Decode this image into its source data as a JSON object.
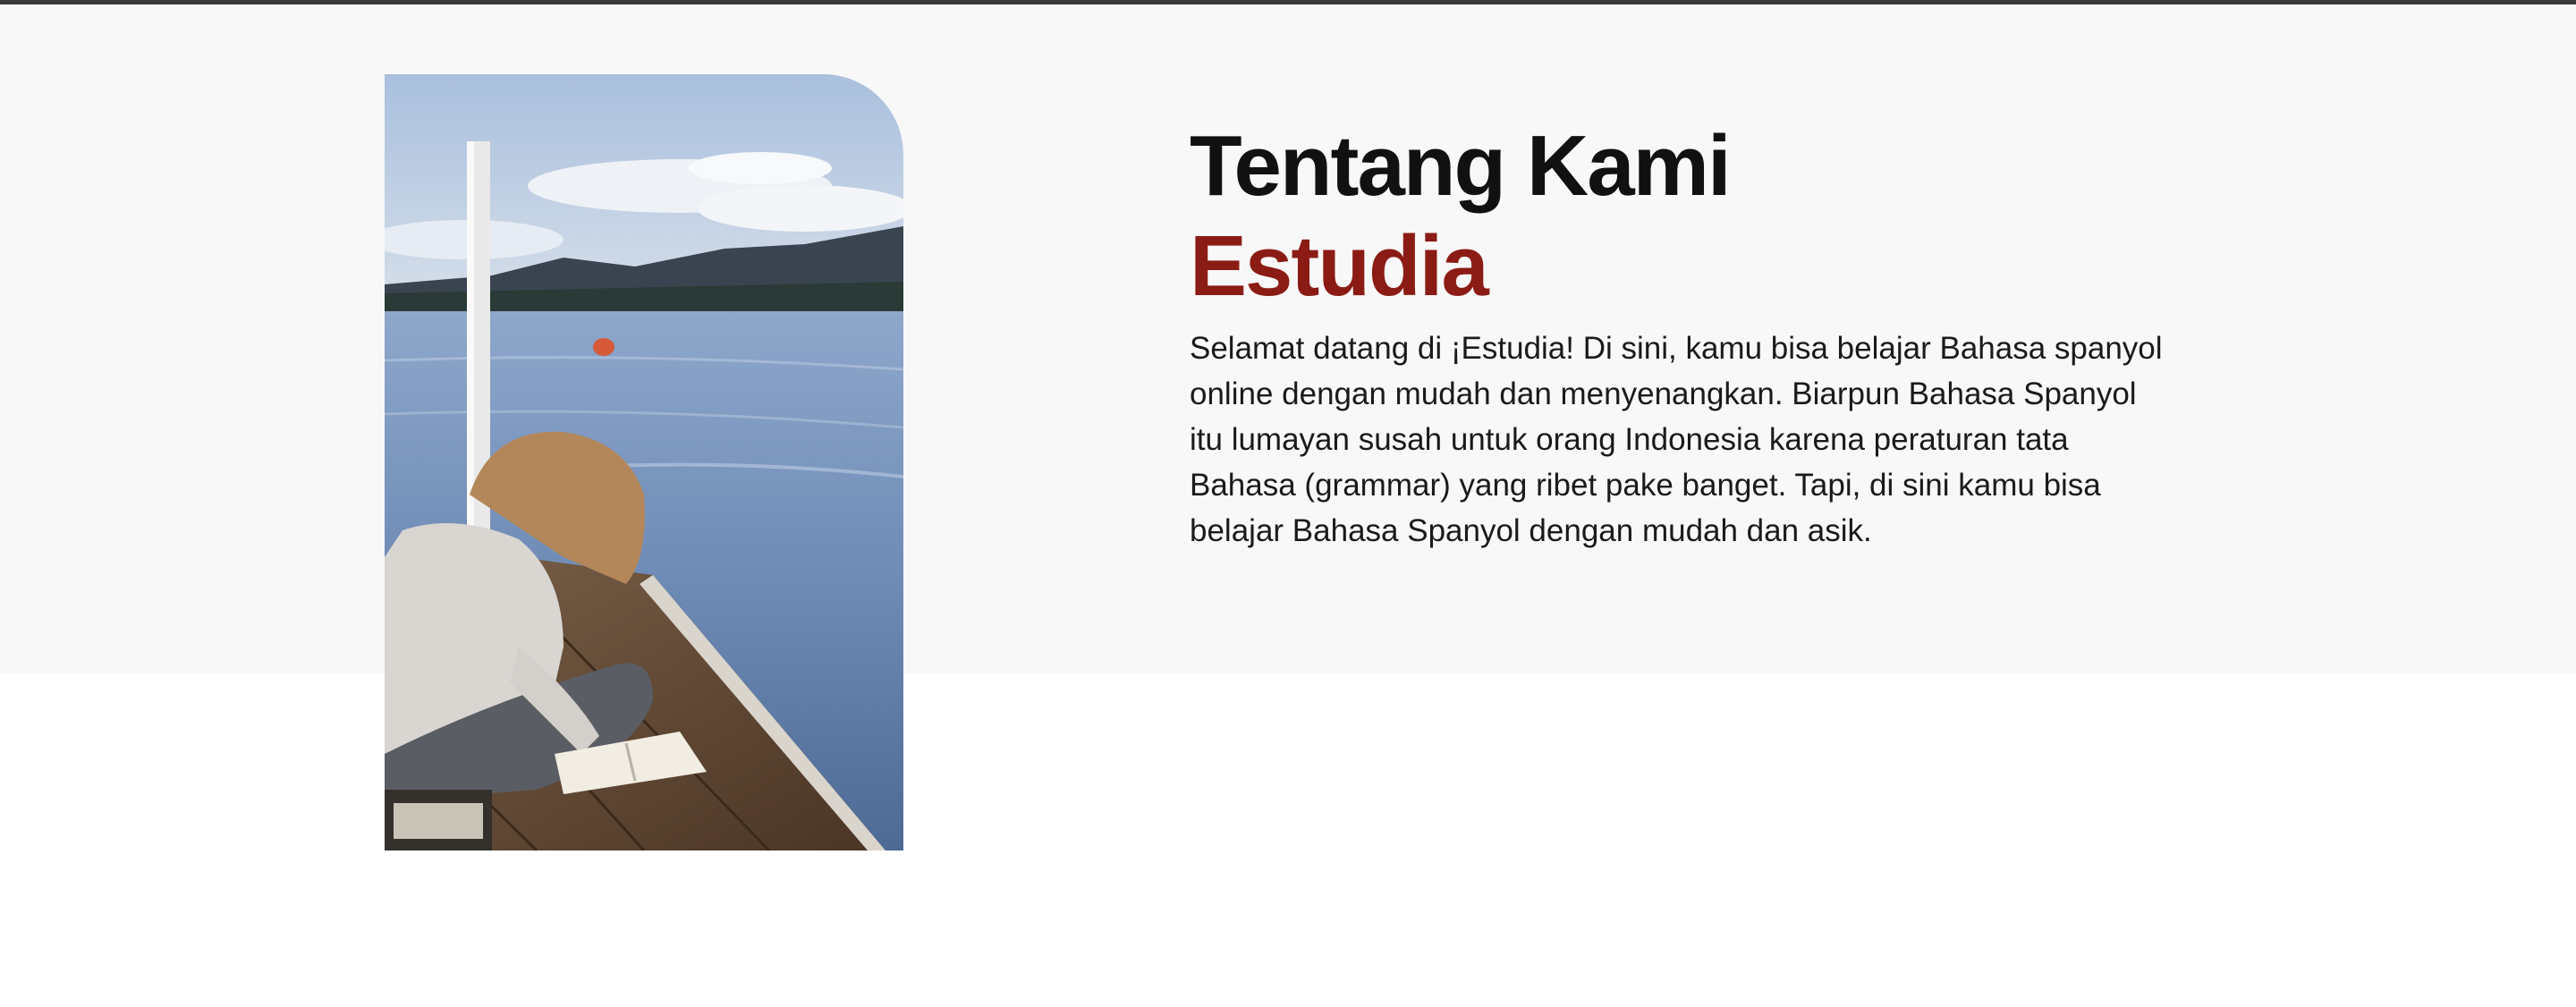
{
  "about": {
    "title_line1": "Tentang Kami",
    "title_line2": "Estudia",
    "description": "Selamat datang di ¡Estudia! Di sini, kamu bisa belajar Bahasa spanyol online dengan mudah dan menyenangkan. Biarpun Bahasa Spanyol itu lumayan susah untuk orang Indonesia karena peraturan tata Bahasa (grammar) yang ribet pake banget. Tapi, di sini kamu bisa belajar Bahasa Spanyol dengan mudah dan asik.",
    "image_alt": "woman reading a book on a lake pier"
  },
  "colors": {
    "heading": "#111111",
    "accent": "#8b1c15",
    "section_background": "#f8f8f8",
    "top_border": "#3a3a3a"
  }
}
